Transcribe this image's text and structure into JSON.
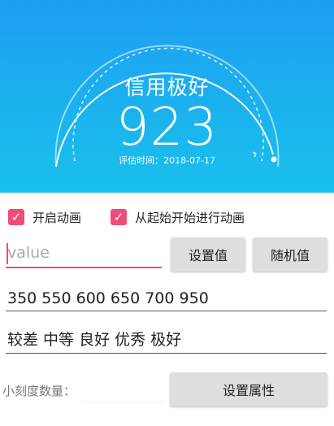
{
  "dial": {
    "title": "信用极好",
    "value": "923",
    "date": "评估时间：2018-07-17",
    "colors": {
      "bg_top": "#1e9ef2",
      "bg_bottom": "#19c0ec",
      "arc": "#ffffff"
    }
  },
  "options": {
    "animate_label": "开启动画",
    "animate_checked": true,
    "from_start_label": "从起始开始进行动画",
    "from_start_checked": true,
    "check_color": "#ef4c7a"
  },
  "value_input": {
    "placeholder": "value",
    "value": ""
  },
  "buttons": {
    "set_value": "设置值",
    "random_value": "随机值",
    "set_attribute": "设置属性"
  },
  "thresholds_field": {
    "value": "350 550 600 650 700 950"
  },
  "levels_field": {
    "value": "较差 中等 良好 优秀 极好"
  },
  "tick_count": {
    "label": "小刻度数量：",
    "value": ""
  }
}
